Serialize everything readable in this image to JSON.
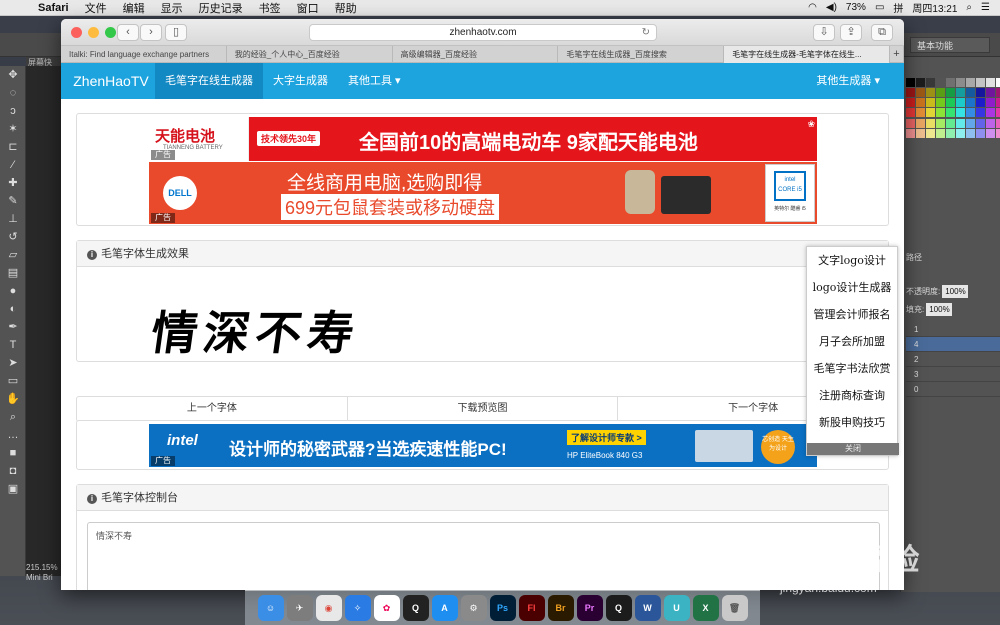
{
  "menubar": {
    "app": "Safari",
    "items": [
      "文件",
      "编辑",
      "显示",
      "历史记录",
      "书签",
      "窗口",
      "帮助"
    ],
    "battery": "73%",
    "input_method": "拼",
    "clock": "周四13:21"
  },
  "photoshop": {
    "workspace": "基本功能",
    "doc_tab": "屏幕快",
    "zoom": "215.15%",
    "status": "Mini Bri",
    "opacity_label": "不透明度:",
    "opacity_value": "100%",
    "fill_label": "填充:",
    "fill_value": "100%",
    "path_label": "路径",
    "layers": [
      "1",
      "4",
      "2",
      "3",
      "0"
    ]
  },
  "browser": {
    "url": "zhenhaotv.com",
    "tabs": [
      "Italki: Find language exchange partners",
      "我的经验_个人中心_百度经验",
      "高级编辑器_百度经验",
      "毛笔字在线生成器_百度搜索",
      "毛笔字在线生成器-毛笔字体在线生..."
    ]
  },
  "site": {
    "brand": "ZhenHaoTV",
    "nav": [
      "毛笔字在线生成器",
      "大字生成器",
      "其他工具 ▾"
    ],
    "nav_right": "其他生成器 ▾",
    "ads": {
      "tag": "广告",
      "ad1_logo": "天能电池",
      "ad1_logo_sub": "TIANNENG BATTERY",
      "ad1_badge": "技术领先30年",
      "ad1_text": "全国前10的高端电动车 9家配天能电池",
      "ad2_logo": "DELL",
      "ad2_line1": "全线商用电脑,选购即得",
      "ad2_line2": "699元包鼠套装或移动硬盘",
      "ad2_chip": "intel CORE i5",
      "ad2_chip_caption": "英特尔 酷睿 i5",
      "ad3_logo": "intel",
      "ad3_text": "设计师的秘密武器?当选疾速性能PC!",
      "ad3_link": "了解设计师专款 >",
      "ad3_model": "HP EliteBook 840 G3",
      "ad3_badge": "芯创造 天生为设计"
    },
    "result_title": "毛笔字体生成效果",
    "calligraphy": "情深不寿",
    "buttons": [
      "上一个字体",
      "下载预览图",
      "下一个字体"
    ],
    "control_title": "毛笔字体控制台",
    "input_value": "情深不寿",
    "side_links": [
      "文字logo设计",
      "logo设计生成器",
      "管理会计师报名",
      "月子会所加盟",
      "毛笔字书法欣赏",
      "注册商标查询",
      "新股申购技巧"
    ],
    "side_close": "关闭"
  },
  "watermark": {
    "brand": "Baidu经验",
    "url": "jingyan.baidu.com"
  },
  "dock": [
    "Finder",
    "Launchpad",
    "Chrome",
    "Safari",
    "Photos",
    "QQ",
    "App Store",
    "System Preferences",
    "Ps",
    "Fl",
    "Br",
    "Pr",
    "QuickTime",
    "W",
    "U",
    "X",
    "Trash"
  ]
}
